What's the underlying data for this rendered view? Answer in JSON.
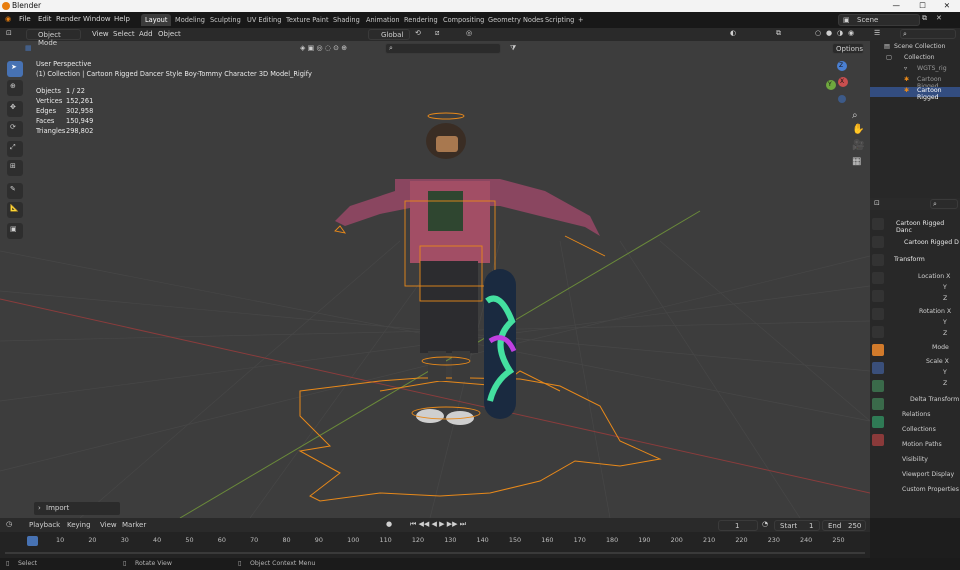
{
  "app": {
    "title": "Blender"
  },
  "menu": [
    "File",
    "Edit",
    "Render",
    "Window",
    "Help"
  ],
  "workspaces": [
    "Layout",
    "Modeling",
    "Sculpting",
    "UV Editing",
    "Texture Paint",
    "Shading",
    "Animation",
    "Rendering",
    "Compositing",
    "Geometry Nodes",
    "Scripting"
  ],
  "workspace_add": "+",
  "scene": {
    "name": "Scene"
  },
  "viewport_header": {
    "mode": "Object Mode",
    "menus": [
      "View",
      "Select",
      "Add",
      "Object"
    ],
    "orientation": "Global",
    "options": "Options"
  },
  "overlay_text": {
    "perspective": "User Perspective",
    "collection": "(1) Collection | Cartoon Rigged Dancer Style Boy-Tommy Character 3D Model_Rigify"
  },
  "stats": [
    {
      "label": "Objects",
      "value": "1 / 22"
    },
    {
      "label": "Vertices",
      "value": "152,261"
    },
    {
      "label": "Edges",
      "value": "302,958"
    },
    {
      "label": "Faces",
      "value": "150,949"
    },
    {
      "label": "Triangles",
      "value": "298,802"
    }
  ],
  "gizmo": {
    "x": "X",
    "y": "Y",
    "z": "Z"
  },
  "last_op": "Import",
  "outliner": {
    "items": [
      {
        "label": "Scene Collection",
        "selected": false
      },
      {
        "label": "Collection",
        "selected": false
      },
      {
        "label": "WGTS_rig",
        "selected": false
      },
      {
        "label": "Cartoon Rigged",
        "selected": false
      },
      {
        "label": "Cartoon Rigged",
        "selected": true
      }
    ]
  },
  "properties": {
    "object_name": "Cartoon Rigged Danc",
    "object_name2": "Cartoon Rigged D",
    "transform": "Transform",
    "location": "Location X",
    "rotation": "Rotation X",
    "mode": "Mode",
    "scale": "Scale X",
    "y": "Y",
    "z": "Z",
    "delta": "Delta Transform",
    "panels": [
      "Relations",
      "Collections",
      "Motion Paths",
      "Visibility",
      "Viewport Display",
      "Custom Properties"
    ]
  },
  "timeline": {
    "menus": [
      "Playback",
      "Keying",
      "View",
      "Marker"
    ],
    "current_frame": "1",
    "start_label": "Start",
    "start": "1",
    "end_label": "End",
    "end": "250",
    "ticks": [
      "1",
      "10",
      "20",
      "30",
      "40",
      "50",
      "60",
      "70",
      "80",
      "90",
      "100",
      "110",
      "120",
      "130",
      "140",
      "150",
      "160",
      "170",
      "180",
      "190",
      "200",
      "210",
      "220",
      "230",
      "240",
      "250"
    ]
  },
  "status": [
    "Select",
    "Rotate View",
    "Object Context Menu"
  ],
  "colors": {
    "accent": "#4772b3",
    "selection": "#e8891a",
    "grid": "#444444",
    "x_axis": "#8a3c3c",
    "y_axis": "#6a8a3a"
  }
}
